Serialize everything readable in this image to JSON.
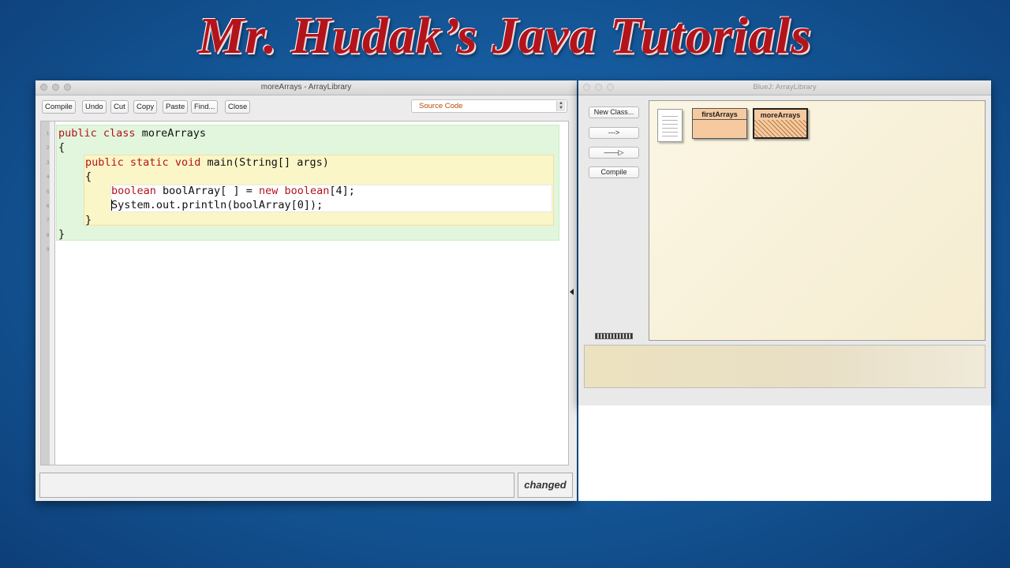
{
  "banner": {
    "text": "Mr. Hudak’s Java Tutorials"
  },
  "editor": {
    "title": "moreArrays - ArrayLibrary",
    "toolbar": [
      "Compile",
      "Undo",
      "Cut",
      "Copy",
      "Paste",
      "Find...",
      "Close"
    ],
    "view_select": "Source Code",
    "line_numbers": [
      "1",
      "2",
      "3",
      "4",
      "5",
      "6",
      "7",
      "8",
      "9"
    ],
    "code": {
      "l1_kw1": "public",
      "l1_kw2": "class",
      "l1_rest": " moreArrays",
      "l2": "{",
      "l3_kw1": "public",
      "l3_kw2": "static",
      "l3_kw3": "void",
      "l3_rest": " main(String[] args)",
      "l4": "{",
      "l5_kw1": "boolean",
      "l5_mid": " boolArray[ ] = ",
      "l5_kw2": "new",
      "l5_kw3": " boolean",
      "l5_rest": "[4];",
      "l6": "System.out.println(boolArray[0]);",
      "l7": "}",
      "l8": "}"
    },
    "status": "changed"
  },
  "bluej": {
    "title": "BlueJ:  ArrayLibrary",
    "buttons": {
      "new_class": "New Class...",
      "dependency_arrow": "--->",
      "inheritance_arrow": "——▷",
      "compile": "Compile"
    },
    "classes": [
      "firstArrays",
      "moreArrays"
    ]
  },
  "colors": {
    "keyword": "#b3141b",
    "banner": "#b3141b",
    "class_fill": "#f6caa0"
  }
}
